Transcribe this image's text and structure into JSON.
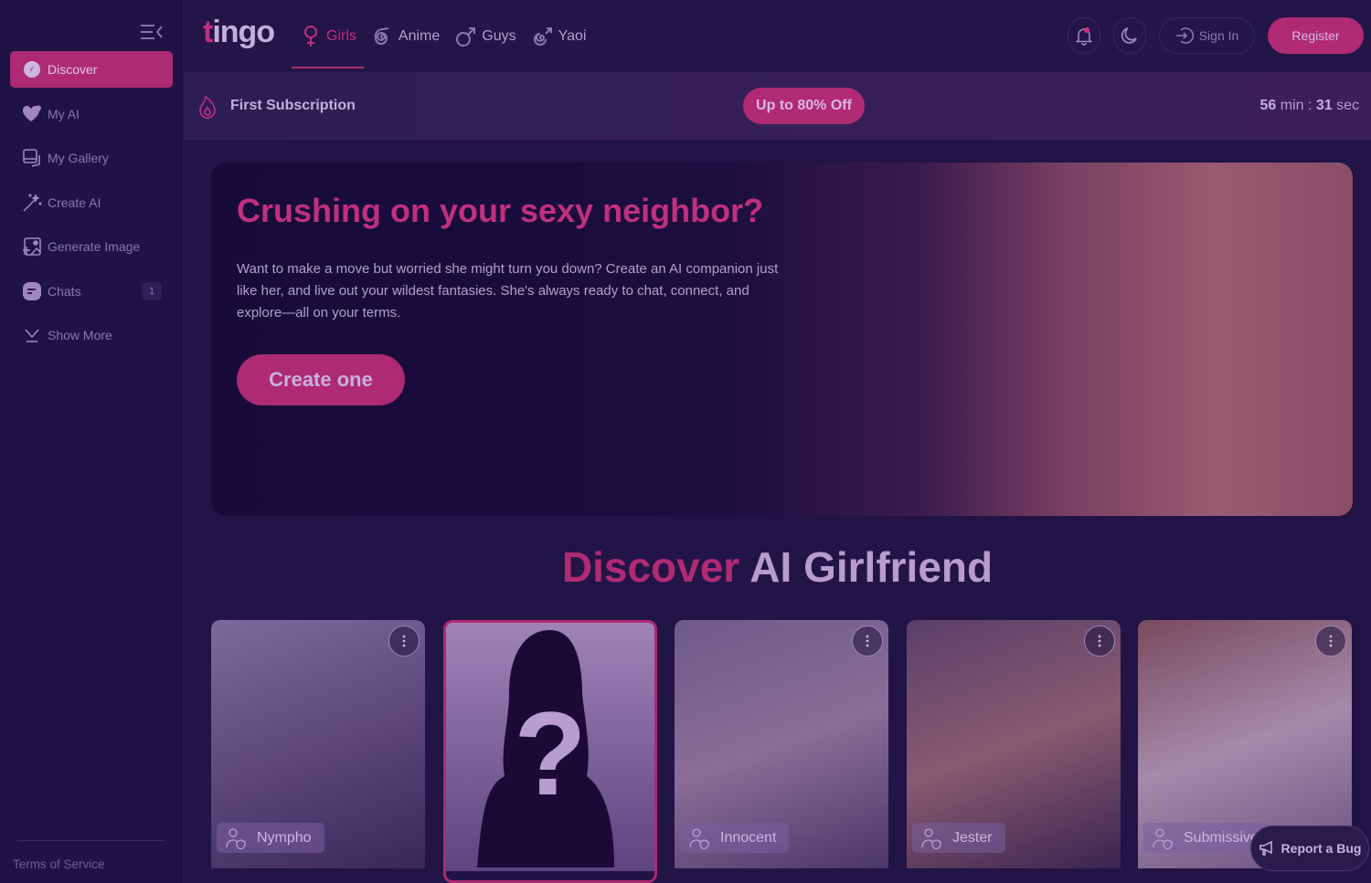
{
  "brand": {
    "logo_first": "t",
    "logo_rest": "ingo"
  },
  "sidebar": {
    "items": [
      {
        "label": "Discover",
        "icon": "compass-icon",
        "active": true
      },
      {
        "label": "My AI",
        "icon": "heart-icon"
      },
      {
        "label": "My Gallery",
        "icon": "gallery-icon"
      },
      {
        "label": "Create AI",
        "icon": "magic-wand-icon"
      },
      {
        "label": "Generate Image",
        "icon": "image-plus-icon"
      },
      {
        "label": "Chats",
        "icon": "chat-icon",
        "badge": "1"
      },
      {
        "label": "Show More",
        "icon": "chevron-down-icon"
      }
    ],
    "footer_link": "Terms of Service"
  },
  "header": {
    "tabs": [
      {
        "label": "Girls",
        "icon": "female-icon",
        "active": true
      },
      {
        "label": "Anime",
        "icon": "swirl-icon"
      },
      {
        "label": "Guys",
        "icon": "male-icon"
      },
      {
        "label": "Yaoi",
        "icon": "swirl-male-icon"
      }
    ],
    "sign_in": "Sign In",
    "register": "Register"
  },
  "promo": {
    "title": "First Subscription",
    "deal": "Up to 80% Off",
    "timer_min": "56",
    "timer_min_unit": "min",
    "timer_sep": ":",
    "timer_sec": "31",
    "timer_sec_unit": "sec"
  },
  "hero": {
    "title": "Crushing on your sexy neighbor?",
    "body": "Want to make a move but worried she might turn you down? Create an AI companion just like her, and live out your wildest fantasies. She's always ready to chat, connect, and explore—all on your terms.",
    "cta": "Create one"
  },
  "section": {
    "title_highlight": "Discover",
    "title_rest": "AI Girlfriend"
  },
  "cards": [
    {
      "label": "Nympho"
    },
    {
      "label": "",
      "mystery": true
    },
    {
      "label": "Innocent"
    },
    {
      "label": "Jester"
    },
    {
      "label": "Submissive"
    }
  ],
  "report_bug": "Report a Bug",
  "colors": {
    "accent": "#ae2a73",
    "background": "#221446",
    "sidebar": "#1f1245"
  }
}
